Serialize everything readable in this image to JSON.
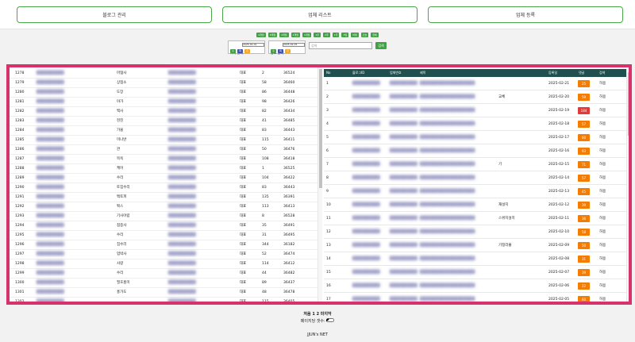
{
  "header": {
    "buttons": [
      "블로그 관리",
      "업체 리스트",
      "업체 등록"
    ]
  },
  "quick_filters": [
    "9개월",
    "6개월",
    "3개월",
    "2개월",
    "1개월",
    "1주",
    "2주",
    "1주",
    "3일",
    "어제",
    "오늘",
    "전체"
  ],
  "filters": {
    "start_label": "시작 날짜:",
    "start_value": "2025-01-01",
    "end_label": "종료 날짜:",
    "end_value": "2025-02-25",
    "small_buttons": [
      "수",
      "목",
      "금"
    ],
    "search_placeholder": "검색",
    "search_button": "검색"
  },
  "left_table": {
    "rows": [
      {
        "id": "1278",
        "blog": "blurred",
        "name": "마협사",
        "addr": "blurred",
        "role": "대표",
        "count": "2",
        "num": "36524"
      },
      {
        "id": "1279",
        "blog": "blurred",
        "name": "상점소",
        "addr": "blurred",
        "role": "대표",
        "count": "58",
        "num": "36460"
      },
      {
        "id": "1280",
        "blog": "blurred",
        "name": "도장",
        "addr": "blurred",
        "role": "대표",
        "count": "86",
        "num": "36448"
      },
      {
        "id": "1281",
        "blog": "blurred",
        "name": "야가",
        "addr": "blurred",
        "role": "대표",
        "count": "98",
        "num": "36426"
      },
      {
        "id": "1282",
        "blog": "blurred",
        "name": "백사",
        "addr": "blurred",
        "role": "대표",
        "count": "82",
        "num": "36434"
      },
      {
        "id": "1283",
        "blog": "blurred",
        "name": "현진",
        "addr": "blurred",
        "role": "대표",
        "count": "41",
        "num": "36485"
      },
      {
        "id": "1284",
        "blog": "blurred",
        "name": "가물",
        "addr": "blurred",
        "role": "대표",
        "count": "83",
        "num": "36443"
      },
      {
        "id": "1285",
        "blog": "blurred",
        "name": "미나반",
        "addr": "blurred",
        "role": "대표",
        "count": "115",
        "num": "36411"
      },
      {
        "id": "1286",
        "blog": "blurred",
        "name": "관",
        "addr": "blurred",
        "role": "대표",
        "count": "50",
        "num": "36476"
      },
      {
        "id": "1287",
        "blog": "blurred",
        "name": "목욕",
        "addr": "blurred",
        "role": "대표",
        "count": "108",
        "num": "36418"
      },
      {
        "id": "1288",
        "blog": "blurred",
        "name": "케어",
        "addr": "blurred",
        "role": "대표",
        "count": "1",
        "num": "36525"
      },
      {
        "id": "1289",
        "blog": "blurred",
        "name": "수리",
        "addr": "blurred",
        "role": "대표",
        "count": "104",
        "num": "36422"
      },
      {
        "id": "1290",
        "blog": "blurred",
        "name": "토집수리",
        "addr": "blurred",
        "role": "대표",
        "count": "83",
        "num": "36443"
      },
      {
        "id": "1291",
        "blog": "blurred",
        "name": "백토피",
        "addr": "blurred",
        "role": "대표",
        "count": "135",
        "num": "36391"
      },
      {
        "id": "1292",
        "blog": "blurred",
        "name": "튁스",
        "addr": "blurred",
        "role": "대표",
        "count": "113",
        "num": "36413"
      },
      {
        "id": "1293",
        "blog": "blurred",
        "name": "기사아랍",
        "addr": "blurred",
        "role": "대표",
        "count": "8",
        "num": "36528"
      },
      {
        "id": "1294",
        "blog": "blurred",
        "name": "점중사",
        "addr": "blurred",
        "role": "대표",
        "count": "35",
        "num": "36491"
      },
      {
        "id": "1295",
        "blog": "blurred",
        "name": "수리",
        "addr": "blurred",
        "role": "대표",
        "count": "31",
        "num": "36495"
      },
      {
        "id": "1296",
        "blog": "blurred",
        "name": "집수리",
        "addr": "blurred",
        "role": "대표",
        "count": "344",
        "num": "36182"
      },
      {
        "id": "1297",
        "blog": "blurred",
        "name": "업박사",
        "addr": "blurred",
        "role": "대표",
        "count": "52",
        "num": "36474"
      },
      {
        "id": "1298",
        "blog": "blurred",
        "name": "사랑",
        "addr": "blurred",
        "role": "대표",
        "count": "114",
        "num": "36412"
      },
      {
        "id": "1299",
        "blog": "blurred",
        "name": "수리",
        "addr": "blurred",
        "role": "대표",
        "count": "44",
        "num": "36482"
      },
      {
        "id": "1300",
        "blog": "blurred",
        "name": "필호홈미",
        "addr": "blurred",
        "role": "대표",
        "count": "89",
        "num": "36437"
      },
      {
        "id": "1301",
        "blog": "blurred",
        "name": "홍가도",
        "addr": "blurred",
        "role": "대표",
        "count": "48",
        "num": "36478"
      },
      {
        "id": "1302",
        "blog": "blurred",
        "name": "",
        "addr": "blurred",
        "role": "대표",
        "count": "115",
        "num": "36405"
      }
    ]
  },
  "right_table": {
    "headers": [
      "No",
      "블로그ID",
      "업체번호",
      "제목",
      "등록일",
      "댓글",
      "검색"
    ],
    "rows": [
      {
        "no": "1",
        "title_tail": "",
        "date": "2025-02-21",
        "badge": "25",
        "badge_color": "#f57c00",
        "status": "허용"
      },
      {
        "no": "2",
        "title_tail": "교체",
        "date": "2025-02-20",
        "badge": "59",
        "badge_color": "#f57c00",
        "status": "허용"
      },
      {
        "no": "3",
        "title_tail": "",
        "date": "2025-02-19",
        "badge": "184",
        "badge_color": "#e53935",
        "status": "허용"
      },
      {
        "no": "4",
        "title_tail": "",
        "date": "2025-02-18",
        "badge": "57",
        "badge_color": "#f57c00",
        "status": "허용"
      },
      {
        "no": "5",
        "title_tail": "",
        "date": "2025-02-17",
        "badge": "60",
        "badge_color": "#f57c00",
        "status": "허용"
      },
      {
        "no": "6",
        "title_tail": "",
        "date": "2025-02-16",
        "badge": "93",
        "badge_color": "#f57c00",
        "status": "허용"
      },
      {
        "no": "7",
        "title_tail": "기",
        "date": "2025-02-15",
        "badge": "71",
        "badge_color": "#f57c00",
        "status": "허용"
      },
      {
        "no": "8",
        "title_tail": "",
        "date": "2025-02-14",
        "badge": "57",
        "badge_color": "#f57c00",
        "status": "허용"
      },
      {
        "no": "9",
        "title_tail": "",
        "date": "2025-02-13",
        "badge": "45",
        "badge_color": "#f57c00",
        "status": "허용"
      },
      {
        "no": "10",
        "title_tail": "재설치",
        "date": "2025-02-12",
        "badge": "39",
        "badge_color": "#f57c00",
        "status": "허용"
      },
      {
        "no": "11",
        "title_tail": "스위치설치",
        "date": "2025-02-11",
        "badge": "36",
        "badge_color": "#f57c00",
        "status": "허용"
      },
      {
        "no": "12",
        "title_tail": "",
        "date": "2025-02-10",
        "badge": "58",
        "badge_color": "#f57c00",
        "status": "허용"
      },
      {
        "no": "13",
        "title_tail": "기정리불",
        "date": "2025-02-09",
        "badge": "50",
        "badge_color": "#f57c00",
        "status": "허용"
      },
      {
        "no": "14",
        "title_tail": "",
        "date": "2025-02-08",
        "badge": "31",
        "badge_color": "#f57c00",
        "status": "허용"
      },
      {
        "no": "15",
        "title_tail": "",
        "date": "2025-02-07",
        "badge": "39",
        "badge_color": "#f57c00",
        "status": "허용"
      },
      {
        "no": "16",
        "title_tail": "",
        "date": "2025-02-06",
        "badge": "22",
        "badge_color": "#f57c00",
        "status": "허용"
      },
      {
        "no": "17",
        "title_tail": "",
        "date": "2025-02-05",
        "badge": "60",
        "badge_color": "#f57c00",
        "status": "허용"
      }
    ]
  },
  "pagination": {
    "text": "처음 1 2 마지막",
    "per_page_label": "페이지당 갯수:",
    "per_page_value": "1000"
  },
  "footer": {
    "text": "JJUN's NET"
  }
}
